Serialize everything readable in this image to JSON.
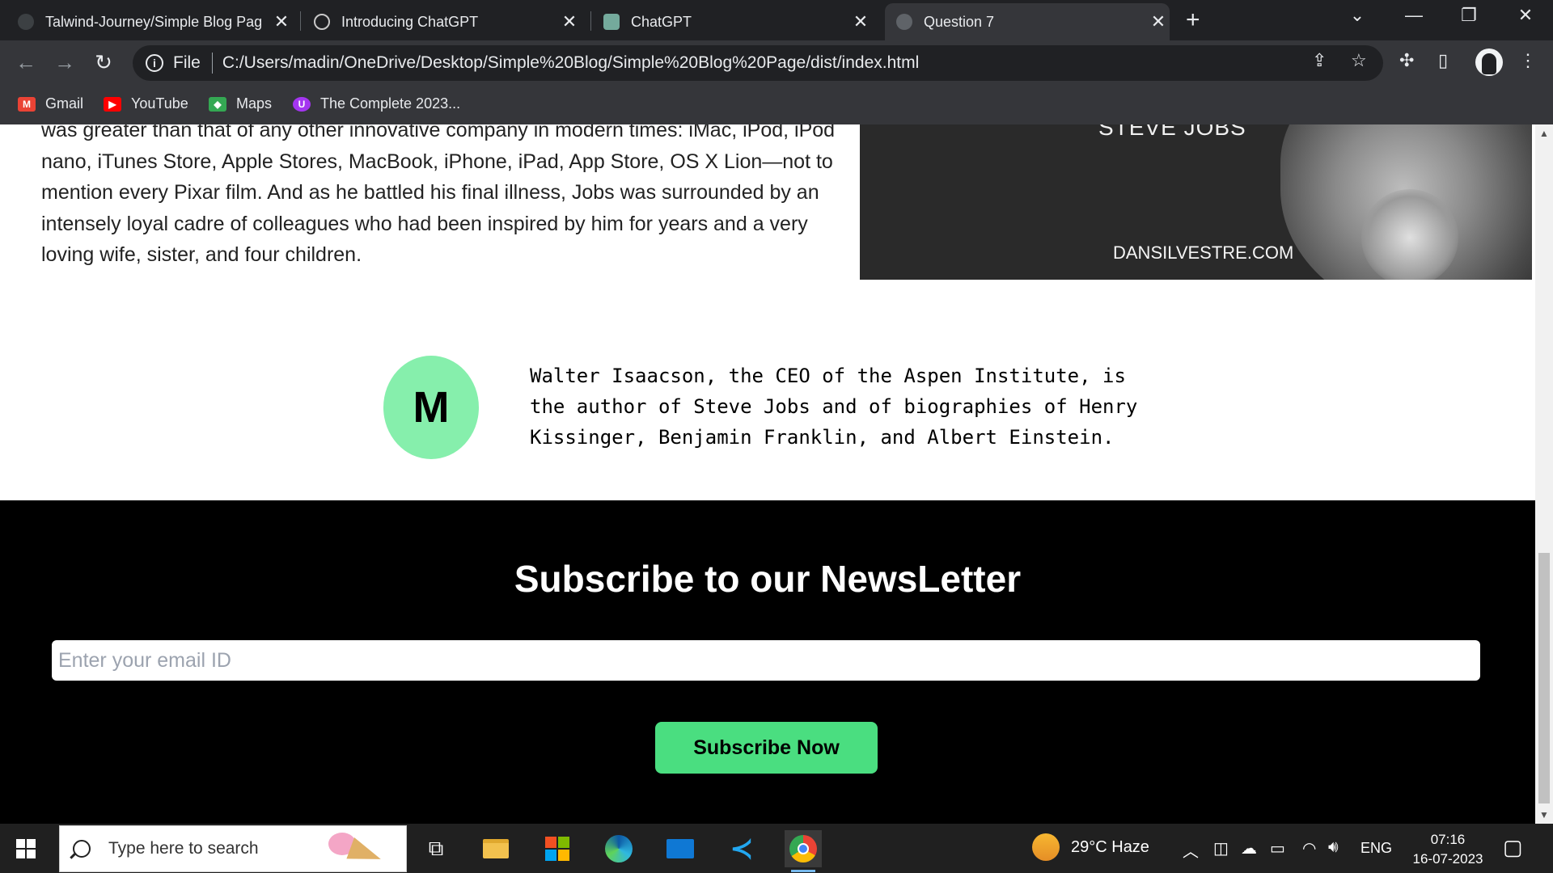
{
  "browser": {
    "tabs": [
      {
        "title": "Talwind-Journey/Simple Blog Pag",
        "icon": "github-icon"
      },
      {
        "title": "Introducing ChatGPT",
        "icon": "openai-icon"
      },
      {
        "title": "ChatGPT",
        "icon": "chatgpt-icon"
      },
      {
        "title": "Question 7",
        "icon": "globe-icon"
      }
    ],
    "address": {
      "scheme_label": "File",
      "url": "C:/Users/madin/OneDrive/Desktop/Simple%20Blog/Simple%20Blog%20Page/dist/index.html"
    },
    "bookmarks": [
      {
        "label": "Gmail",
        "icon": "gmail-icon",
        "color": "#ea4335"
      },
      {
        "label": "YouTube",
        "icon": "youtube-icon",
        "color": "#ff0000"
      },
      {
        "label": "Maps",
        "icon": "maps-icon",
        "color": "#34a853"
      },
      {
        "label": "The Complete 2023...",
        "icon": "udemy-icon",
        "color": "#a435f0"
      }
    ]
  },
  "page": {
    "article_text": "was greater than that of any other innovative company in modern times: iMac, iPod, iPod nano, iTunes Store, Apple Stores, MacBook, iPhone, iPad, App Store, OS X Lion—not to mention every Pixar film. And as he battled his final illness, Jobs was surrounded by an intensely loyal cadre of colleagues who had been inspired by him for years and a very loving wife, sister, and four children.",
    "hero": {
      "caption_top": "STEVE JOBS",
      "caption_bottom": "DANSILVESTRE.COM"
    },
    "author": {
      "initial": "M",
      "avatar_color": "#86efac",
      "bio": "Walter Isaacson, the CEO of the Aspen Institute, is the author of Steve Jobs and of biographies of Henry Kissinger, Benjamin Franklin, and Albert Einstein."
    },
    "newsletter": {
      "title": "Subscribe to our NewsLetter",
      "email_placeholder": "Enter your email ID",
      "button_label": "Subscribe Now",
      "button_color": "#4ade80"
    }
  },
  "taskbar": {
    "search_placeholder": "Type here to search",
    "weather": "29°C Haze",
    "language": "ENG",
    "time": "07:16",
    "date": "16-07-2023"
  }
}
